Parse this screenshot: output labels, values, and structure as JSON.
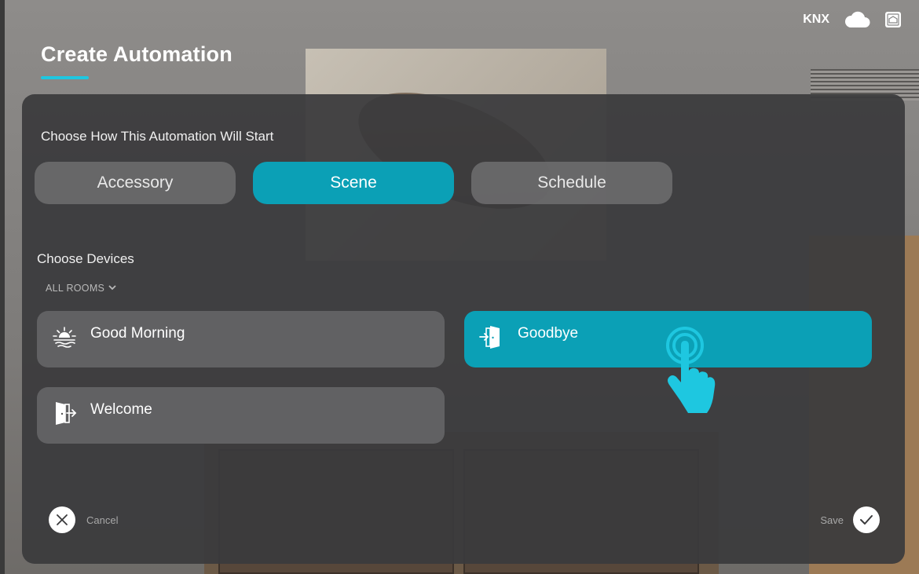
{
  "header": {
    "title": "Create Automation",
    "status_label": "KNX",
    "icons": [
      "cloud-icon",
      "home-icon"
    ]
  },
  "start_section": {
    "label": "Choose How This Automation Will Start",
    "options": [
      {
        "label": "Accessory",
        "selected": false
      },
      {
        "label": "Scene",
        "selected": true
      },
      {
        "label": "Schedule",
        "selected": false
      }
    ]
  },
  "devices_section": {
    "label": "Choose Devices",
    "room_filter": "ALL ROOMS",
    "scenes": [
      {
        "label": "Good Morning",
        "icon": "sunrise-icon",
        "selected": false
      },
      {
        "label": "Goodbye",
        "icon": "door-exit-icon",
        "selected": true
      },
      {
        "label": "Welcome",
        "icon": "door-enter-icon",
        "selected": false
      }
    ]
  },
  "footer": {
    "cancel_label": "Cancel",
    "save_label": "Save"
  },
  "colors": {
    "accent": "#0ba0b6",
    "underline": "#1ec7e0",
    "pointer": "#1ec7e0",
    "panel": "#3a3a3c"
  }
}
